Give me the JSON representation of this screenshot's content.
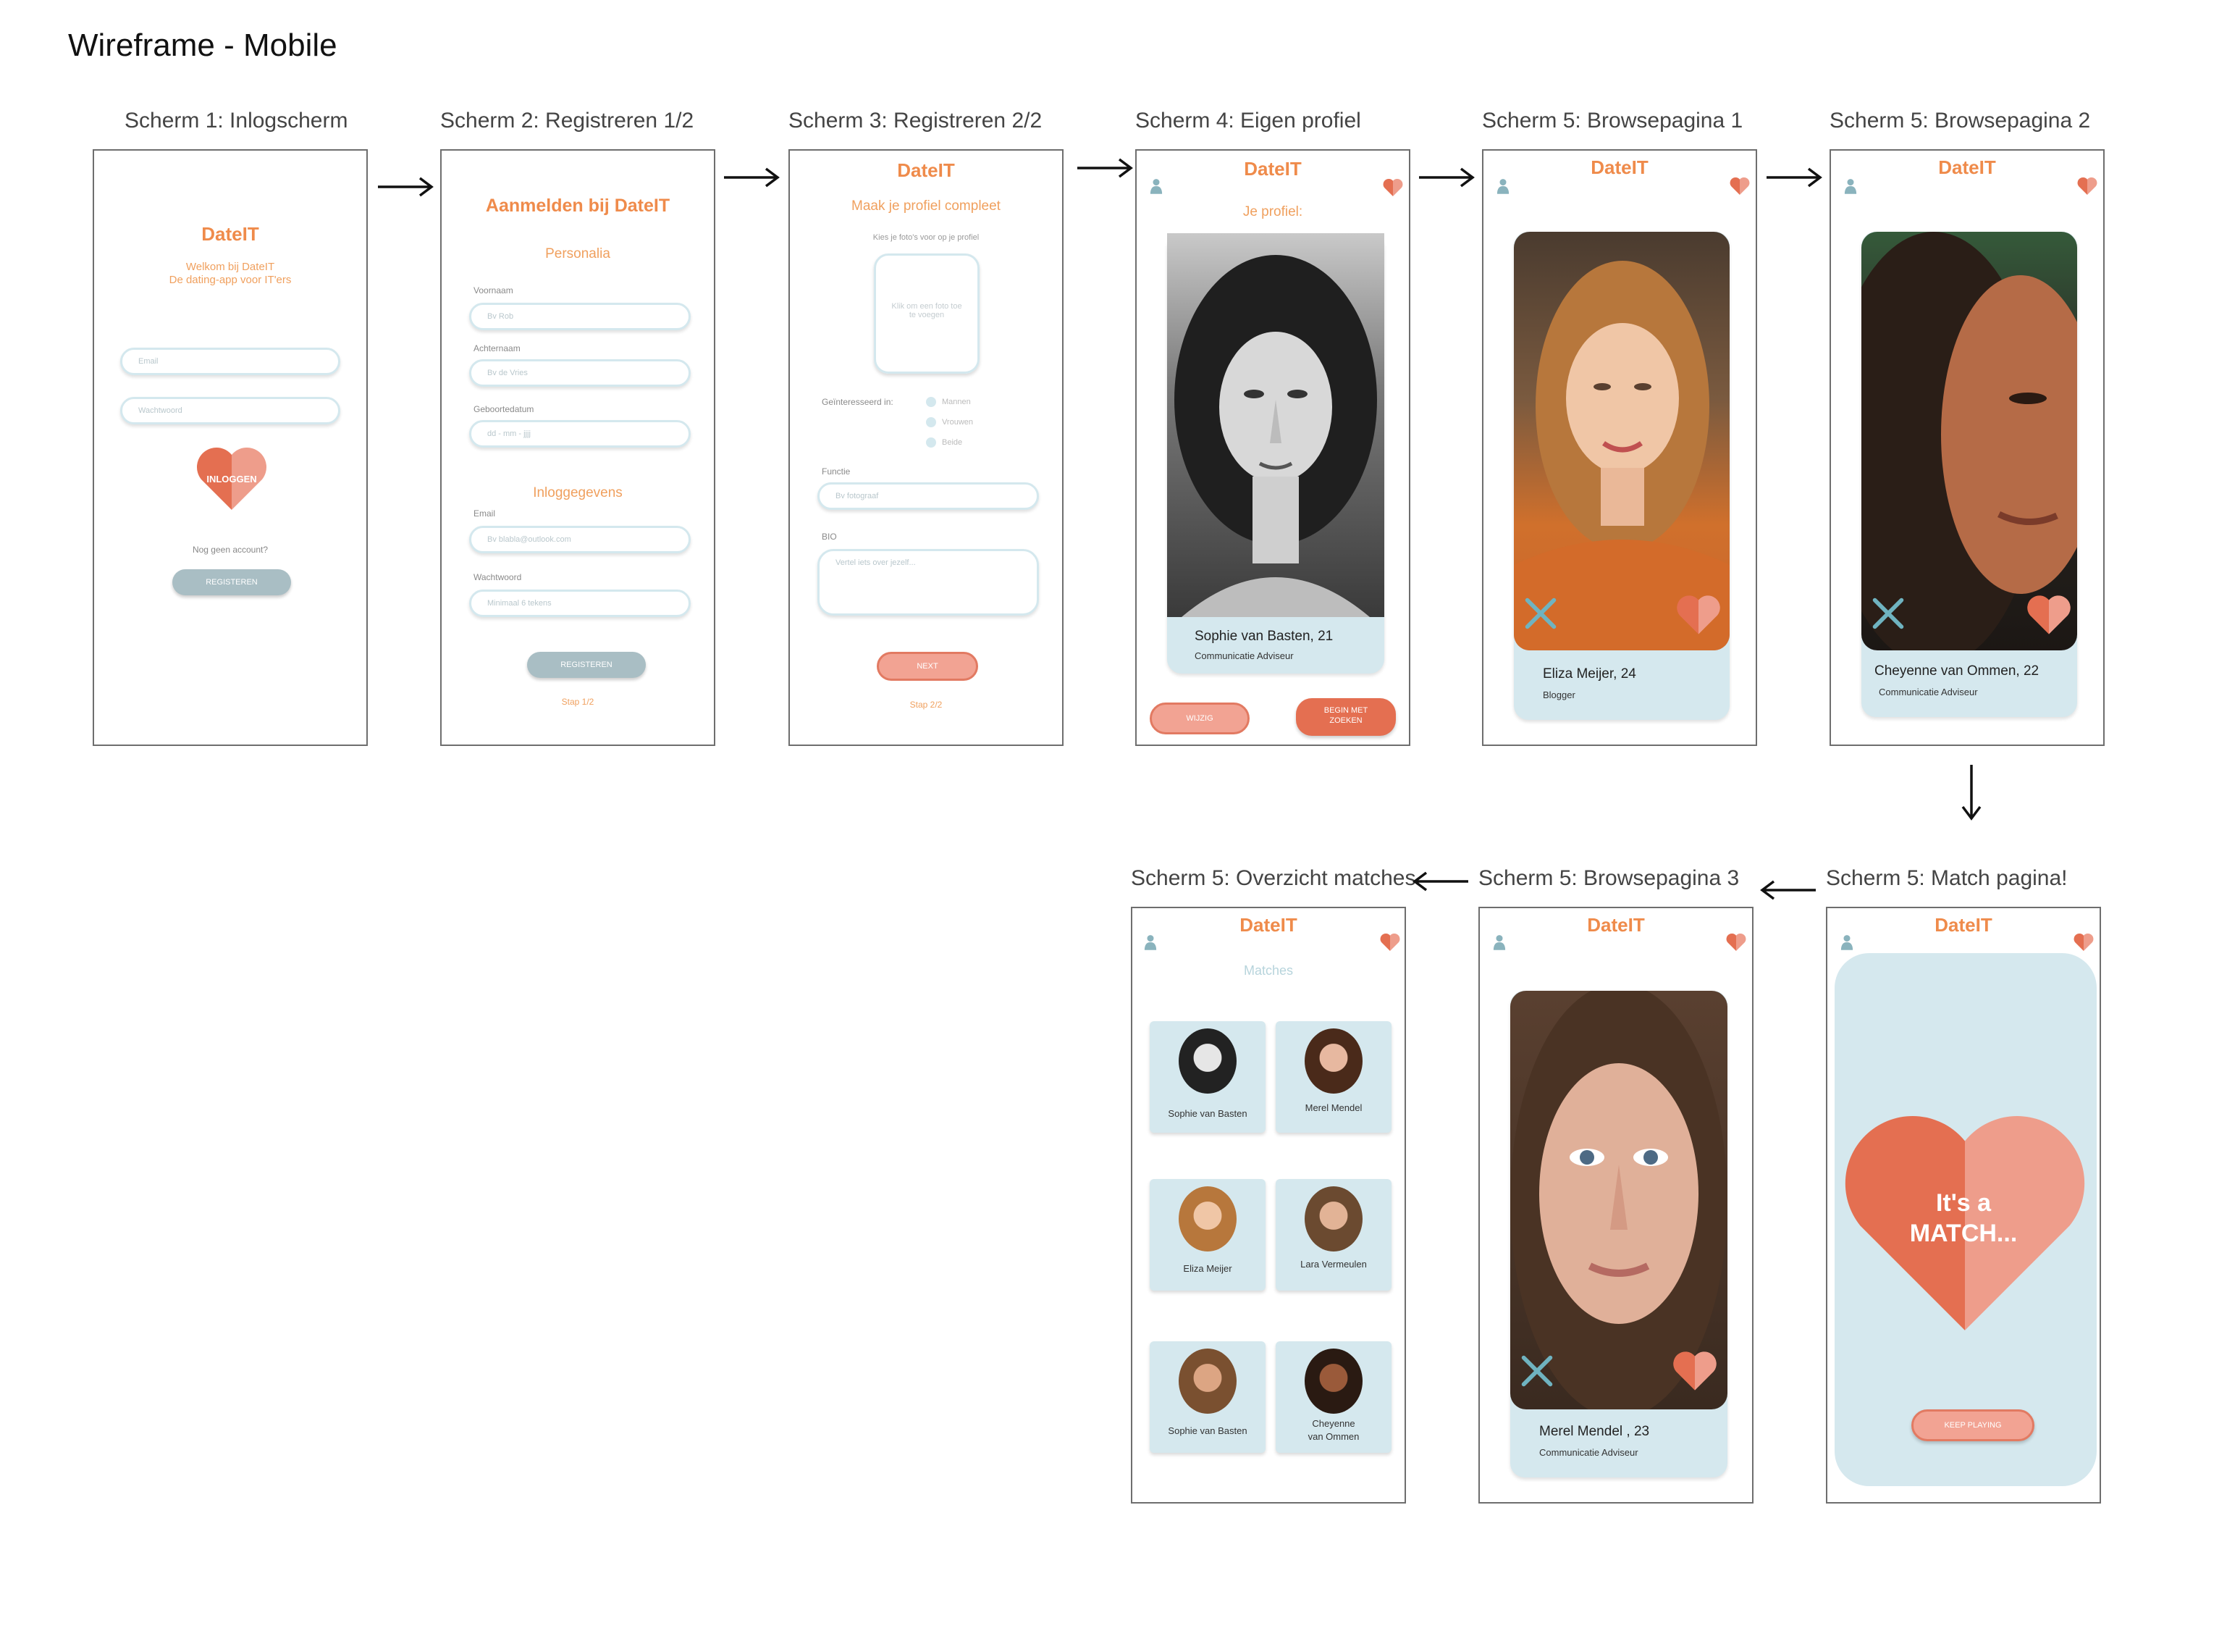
{
  "doc_title": "Wireframe - Mobile",
  "colors": {
    "brand": "#ef8b4b",
    "heart_dark": "#e46f51",
    "heart_light": "#ee9d8b",
    "card_blue": "#d5e8ee",
    "button_grey": "#a9bec4"
  },
  "screens": {
    "s1": {
      "caption": "Scherm 1: Inlogscherm",
      "logo": "DateIT",
      "welcome1": "Welkom bij DateIT",
      "welcome2": "De dating-app voor IT'ers",
      "email_ph": "Email",
      "password_ph": "Wachtwoord",
      "login": "INLOGGEN",
      "no_account": "Nog geen account?",
      "register": "REGISTEREN"
    },
    "s2": {
      "caption": "Scherm 2: Registreren 1/2",
      "title": "Aanmelden bij DateIT",
      "section1": "Personalia",
      "firstname_lbl": "Voornaam",
      "firstname_ph": "Bv Rob",
      "lastname_lbl": "Achternaam",
      "lastname_ph": "Bv de Vries",
      "dob_lbl": "Geboortedatum",
      "dob_ph": "dd - mm - jjjj",
      "section2": "Inloggegevens",
      "email_lbl": "Email",
      "email_ph": "Bv blabla@outlook.com",
      "pw_lbl": "Wachtwoord",
      "pw_ph": "Minimaal 6 tekens",
      "register": "REGISTEREN",
      "step": "Stap 1/2"
    },
    "s3": {
      "caption": "Scherm 3: Registreren 2/2",
      "logo": "DateIT",
      "title": "Maak je profiel compleet",
      "photo_hint": "Kies je foto's voor op je profiel",
      "photo_box": "Klik om een foto toe te voegen",
      "interest_lbl": "Geïnteresseerd in:",
      "opt1": "Mannen",
      "opt2": "Vrouwen",
      "opt3": "Beide",
      "function_lbl": "Functie",
      "function_ph": "Bv fotograaf",
      "bio_lbl": "BIO",
      "bio_ph": "Vertel iets over jezelf...",
      "next": "NEXT",
      "step": "Stap 2/2"
    },
    "s4": {
      "caption": "Scherm 4: Eigen profiel",
      "logo": "DateIT",
      "heading": "Je profiel:",
      "name": "Sophie van Basten, 21",
      "job": "Communicatie Adviseur",
      "edit": "WIJZIG",
      "start1": "BEGIN MET",
      "start2": "ZOEKEN"
    },
    "s5": {
      "caption": "Scherm 5: Browsepagina 1",
      "logo": "DateIT",
      "name": "Eliza Meijer, 24",
      "job": "Blogger"
    },
    "s6": {
      "caption": "Scherm 5: Browsepagina 2",
      "logo": "DateIT",
      "name": "Cheyenne van Ommen, 22",
      "job": "Communicatie Adviseur"
    },
    "s7": {
      "caption": "Scherm 5: Overzicht matches",
      "logo": "DateIT",
      "heading": "Matches",
      "tiles": [
        "Sophie van Basten",
        "Merel Mendel",
        "Eliza Meijer",
        "Lara Vermeulen",
        "Sophie van Basten",
        "Cheyenne",
        "van Ommen"
      ]
    },
    "s8": {
      "caption": "Scherm 5: Browsepagina 3",
      "logo": "DateIT",
      "name": "Merel Mendel , 23",
      "job": "Communicatie Adviseur"
    },
    "s9": {
      "caption": "Scherm 5: Match pagina!",
      "logo": "DateIT",
      "match1": "It's a",
      "match2": "MATCH...",
      "keep": "KEEP PLAYING"
    }
  }
}
